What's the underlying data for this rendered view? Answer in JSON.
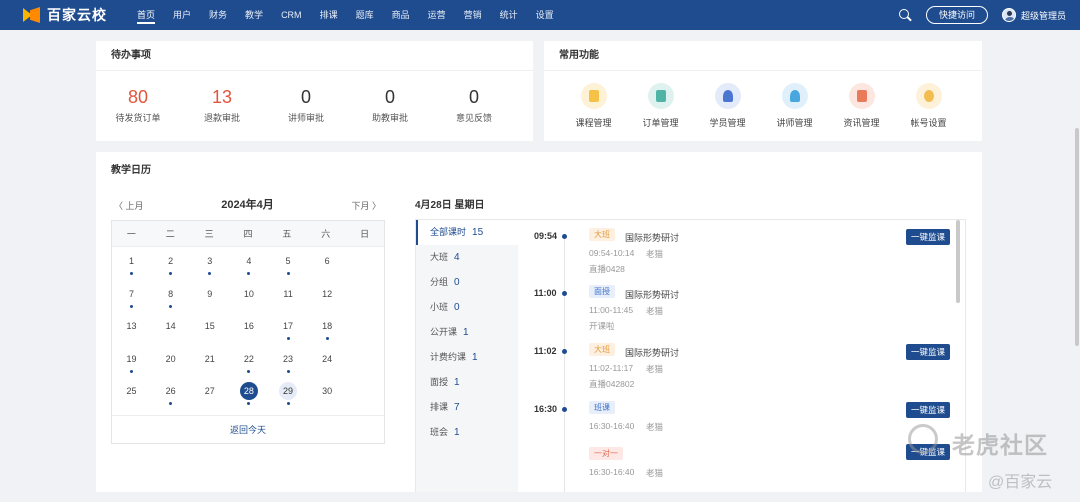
{
  "brand": {
    "name": "百家云校"
  },
  "nav": {
    "items": [
      "首页",
      "用户",
      "财务",
      "教学",
      "CRM",
      "排课",
      "题库",
      "商品",
      "运营",
      "营销",
      "统计",
      "设置"
    ],
    "active": "首页"
  },
  "header": {
    "quick_access": "快捷访问",
    "user_name": "超级管理员"
  },
  "todo": {
    "title": "待办事项",
    "items": [
      {
        "value": "80",
        "label": "待发货订单",
        "accent": "#e0553c"
      },
      {
        "value": "13",
        "label": "退款审批",
        "accent": "#e0553c"
      },
      {
        "value": "0",
        "label": "讲师审批"
      },
      {
        "value": "0",
        "label": "助教审批"
      },
      {
        "value": "0",
        "label": "意见反馈"
      }
    ]
  },
  "common": {
    "title": "常用功能",
    "items": [
      {
        "label": "课程管理",
        "icon": "course-icon"
      },
      {
        "label": "订单管理",
        "icon": "order-icon"
      },
      {
        "label": "学员管理",
        "icon": "student-icon"
      },
      {
        "label": "讲师管理",
        "icon": "teacher-icon"
      },
      {
        "label": "资讯管理",
        "icon": "news-icon"
      },
      {
        "label": "帐号设置",
        "icon": "account-icon"
      }
    ]
  },
  "calendar": {
    "title": "教学日历",
    "prev": "〈 上月",
    "next": "下月 〉",
    "month": "2024年4月",
    "weekdays": [
      "一",
      "二",
      "三",
      "四",
      "五",
      "六",
      "日"
    ],
    "days": [
      {
        "d": "1",
        "dot": true
      },
      {
        "d": "2",
        "dot": true
      },
      {
        "d": "3",
        "dot": true
      },
      {
        "d": "4",
        "dot": true
      },
      {
        "d": "5",
        "dot": true
      },
      {
        "d": "6",
        "dot": false
      },
      {
        "d": "7",
        "dot": true
      },
      {
        "d": "8",
        "dot": true
      },
      {
        "d": "9",
        "dot": false
      },
      {
        "d": "10",
        "dot": false
      },
      {
        "d": "11",
        "dot": false
      },
      {
        "d": "12",
        "dot": false
      },
      {
        "d": "13",
        "dot": false
      },
      {
        "d": "14",
        "dot": false
      },
      {
        "d": "15",
        "dot": false
      },
      {
        "d": "16",
        "dot": false
      },
      {
        "d": "17",
        "dot": true
      },
      {
        "d": "18",
        "dot": true
      },
      {
        "d": "19",
        "dot": true
      },
      {
        "d": "20",
        "dot": false
      },
      {
        "d": "21",
        "dot": false
      },
      {
        "d": "22",
        "dot": true
      },
      {
        "d": "23",
        "dot": true
      },
      {
        "d": "24",
        "dot": false
      },
      {
        "d": "25",
        "dot": false
      },
      {
        "d": "26",
        "dot": true
      },
      {
        "d": "27",
        "dot": false
      },
      {
        "d": "28",
        "dot": true,
        "today": true
      },
      {
        "d": "29",
        "dot": true,
        "selected": true
      },
      {
        "d": "30",
        "dot": false
      }
    ],
    "back_today": "返回今天"
  },
  "schedule": {
    "date": "4月28日  星期日",
    "categories": [
      {
        "label": "全部课时",
        "count": "15",
        "active": true
      },
      {
        "label": "大班",
        "count": "4"
      },
      {
        "label": "分组",
        "count": "0"
      },
      {
        "label": "小班",
        "count": "0"
      },
      {
        "label": "公开课",
        "count": "1"
      },
      {
        "label": "计费约课",
        "count": "1"
      },
      {
        "label": "面授",
        "count": "1"
      },
      {
        "label": "排课",
        "count": "7"
      },
      {
        "label": "班会",
        "count": "1"
      }
    ],
    "events": [
      {
        "time": "09:54",
        "tag": "大班",
        "tag_style": "orange",
        "name": "国际形势研讨",
        "range": "09:54-10:14",
        "teacher": "老猫",
        "extra": "直播0428",
        "button": "一键监课"
      },
      {
        "time": "11:00",
        "tag": "面授",
        "tag_style": "blue",
        "name": "国际形势研讨",
        "range": "11:00-11:45",
        "teacher": "老猫",
        "extra": "开课啦",
        "button": ""
      },
      {
        "time": "11:02",
        "tag": "大班",
        "tag_style": "orange",
        "name": "国际形势研讨",
        "range": "11:02-11:17",
        "teacher": "老猫",
        "extra": "直播042802",
        "button": "一键监课"
      },
      {
        "time": "16:30",
        "tag": "班课",
        "tag_style": "blue",
        "name": "",
        "range": "16:30-16:40",
        "teacher": "老猫",
        "extra": "",
        "button": "一键监课"
      },
      {
        "time": "",
        "tag": "一对一",
        "tag_style": "red",
        "name": "",
        "range": "16:30-16:40",
        "teacher": "老猫",
        "extra": "",
        "button": "一键监课"
      }
    ]
  },
  "watermark": {
    "line1": "老虎社区",
    "line2": "@百家云"
  }
}
